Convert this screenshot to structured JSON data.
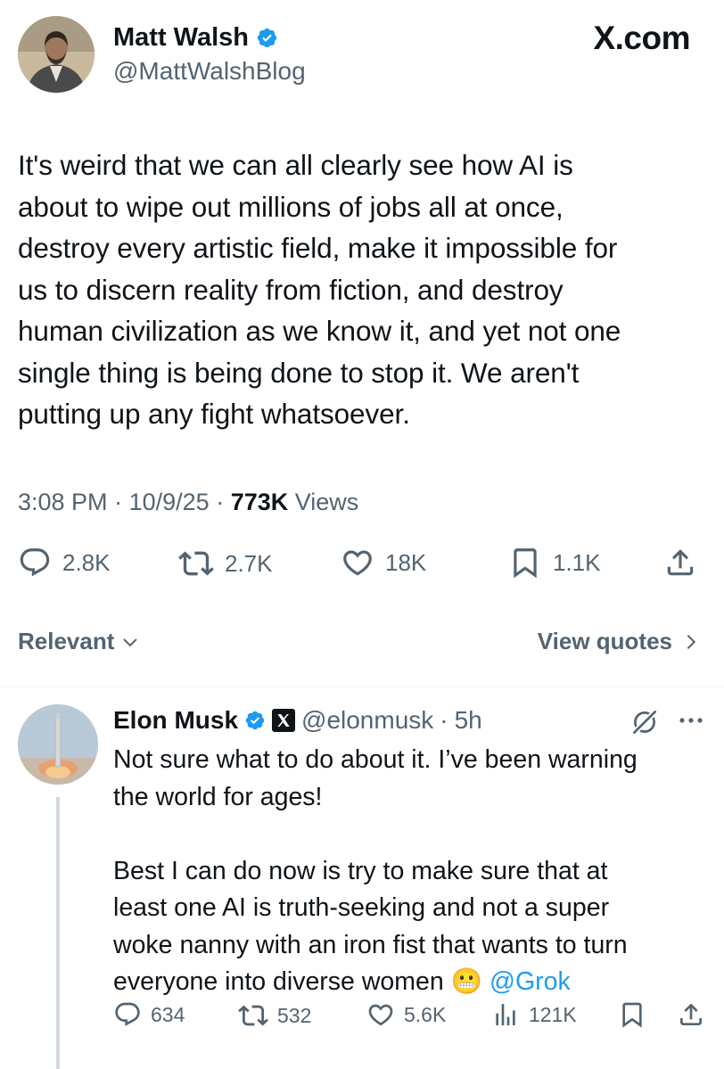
{
  "main_tweet": {
    "author_name": "Matt Walsh",
    "author_handle": "@MattWalshBlog",
    "site_label": "X.com",
    "text_lines": [
      "It's weird that we can all clearly see how AI is",
      "about to wipe out millions of jobs all at once,",
      "destroy every artistic field, make it impossible for",
      "us to discern reality from fiction, and destroy",
      "human civilization as we know it, and yet not one",
      "single thing is being done to stop it. We aren't",
      "putting up any fight whatsoever."
    ],
    "time": "3:08 PM",
    "date": "10/9/25",
    "views_count": "773K",
    "views_label": "Views",
    "replies": "2.8K",
    "reposts": "2.7K",
    "likes": "18K",
    "bookmarks": "1.1K"
  },
  "sort": {
    "relevant_label": "Relevant",
    "view_quotes_label": "View quotes"
  },
  "reply": {
    "author_name": "Elon Musk",
    "author_handle": "@elonmusk",
    "time_ago": "5h",
    "text_lines_1": [
      "Not sure what to do about it. I’ve been warning",
      "the world for ages!"
    ],
    "text_lines_2": [
      "Best I can do now is try to make sure that at",
      "least one AI is truth-seeking and not a super",
      "woke nanny with an iron fist that wants to turn"
    ],
    "last_line": "everyone into diverse women",
    "emoji": "😬",
    "mention": "@Grok",
    "replies": "634",
    "reposts": "532",
    "likes": "5.6K",
    "views": "121K"
  },
  "icons": {
    "verified": "verified-badge-icon",
    "x_logo": "x-logo-icon",
    "reply": "reply-icon",
    "repost": "repost-icon",
    "like": "heart-icon",
    "bookmark": "bookmark-icon",
    "share": "share-icon",
    "views": "bar-chart-icon",
    "grok": "grok-icon",
    "more": "more-icon"
  },
  "colors": {
    "text": "#0f1419",
    "secondary": "#536471",
    "verified": "#1d9bf0",
    "link": "#1d9bf0"
  }
}
